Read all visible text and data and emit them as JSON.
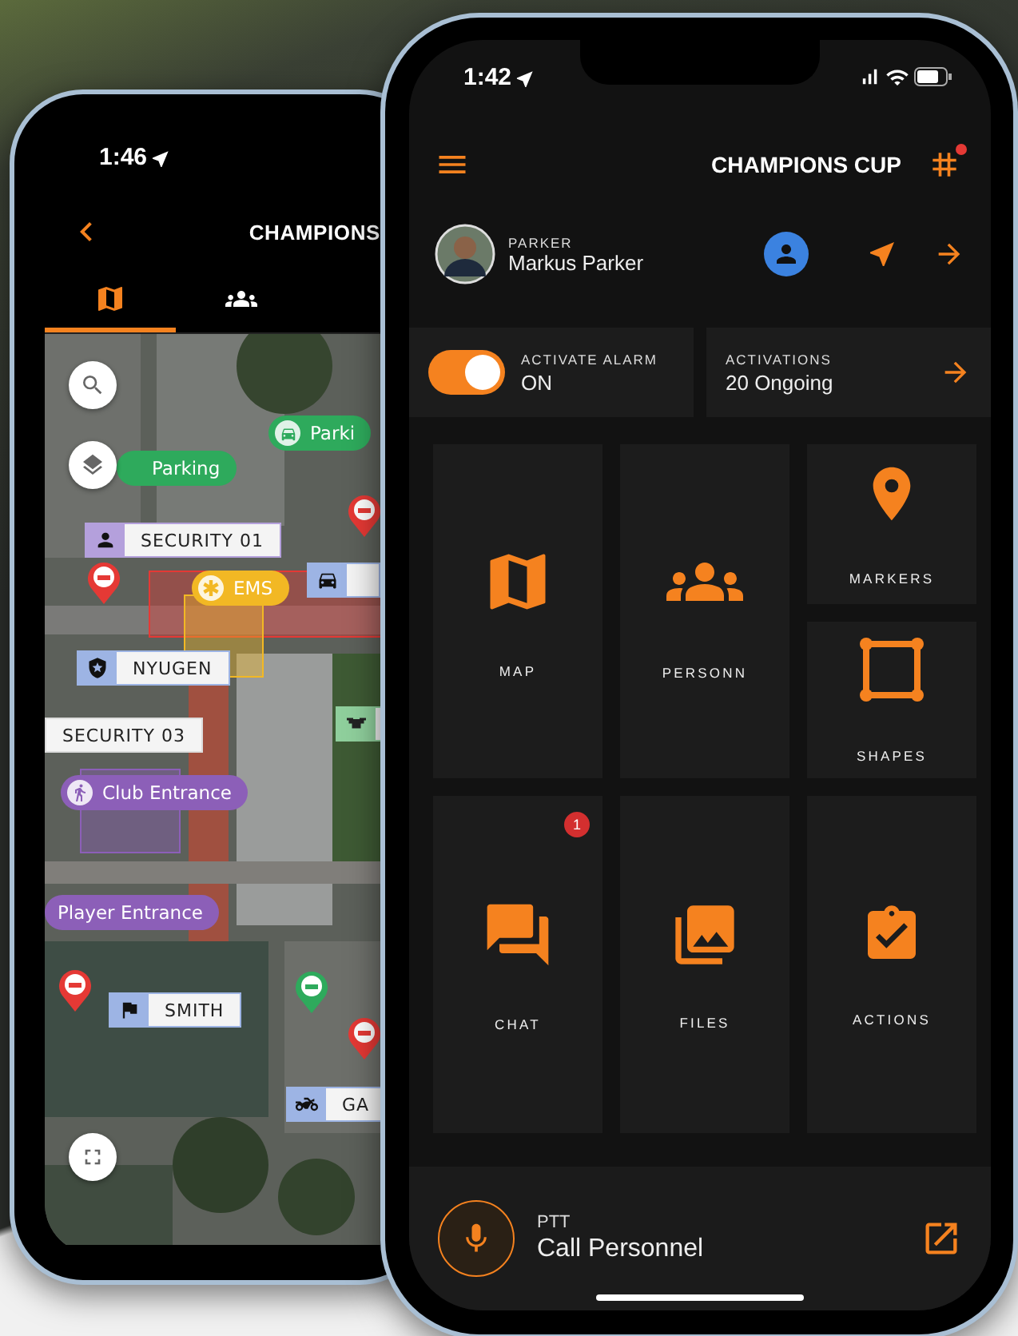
{
  "left_phone": {
    "status_bar": {
      "time": "1:46"
    },
    "header": {
      "title": "CHAMPIONS"
    },
    "tabs": [
      {
        "selected": true
      },
      {
        "selected": false
      }
    ],
    "map": {
      "markers": [
        {
          "kind": "zone",
          "color": "#e53935"
        },
        {
          "kind": "zone",
          "color": "#f2b824"
        },
        {
          "kind": "zone",
          "color": "#8c5fb8"
        },
        {
          "kind": "pill",
          "text": "Parking",
          "color": "#2eaa5c"
        },
        {
          "kind": "pill",
          "text": "Parki",
          "color": "#2eaa5c"
        },
        {
          "kind": "tag",
          "text": "SECURITY 01",
          "color": "#b4a0dc"
        },
        {
          "kind": "pin",
          "color": "#e53935"
        },
        {
          "kind": "pin",
          "color": "#e53935"
        },
        {
          "kind": "pill",
          "text": "EMS",
          "color": "#f2b824"
        },
        {
          "kind": "tag",
          "color": "#9db4e4"
        },
        {
          "kind": "tag",
          "text": "NYUGEN",
          "color": "#9db4e4"
        },
        {
          "kind": "tag",
          "color": "#8fcf9c"
        },
        {
          "kind": "label",
          "text": "SECURITY 03"
        },
        {
          "kind": "pill",
          "text": "Club Entrance",
          "color": "#8c5fb8"
        },
        {
          "kind": "pill",
          "text": "Player Entrance",
          "color": "#8c5fb8"
        },
        {
          "kind": "pin",
          "color": "#e53935"
        },
        {
          "kind": "tag",
          "text": "SMITH",
          "color": "#9db4e4"
        },
        {
          "kind": "pin",
          "color": "#2eaa5c"
        },
        {
          "kind": "pin",
          "color": "#e53935"
        },
        {
          "kind": "tag",
          "text": "GA",
          "color": "#9db4e4"
        }
      ]
    }
  },
  "right_phone": {
    "status_bar": {
      "time": "1:42"
    },
    "header": {
      "title": "CHAMPIONS CUP",
      "notification": true
    },
    "profile": {
      "role": "PARKER",
      "name": "Markus Parker"
    },
    "alarm": {
      "label": "ACTIVATE ALARM",
      "status": "ON",
      "on": true
    },
    "activations": {
      "label": "ACTIVATIONS",
      "count": "20 Ongoing"
    },
    "tiles": [
      {
        "label": "MAP"
      },
      {
        "label": "PERSONN"
      },
      {
        "label": "MARKERS"
      },
      {
        "label": "SHAPES"
      },
      {
        "label": "CHAT",
        "badge": "1"
      },
      {
        "label": "FILES"
      },
      {
        "label": "ACTIONS"
      }
    ],
    "ptt": {
      "label": "PTT",
      "action": "Call Personnel"
    }
  }
}
